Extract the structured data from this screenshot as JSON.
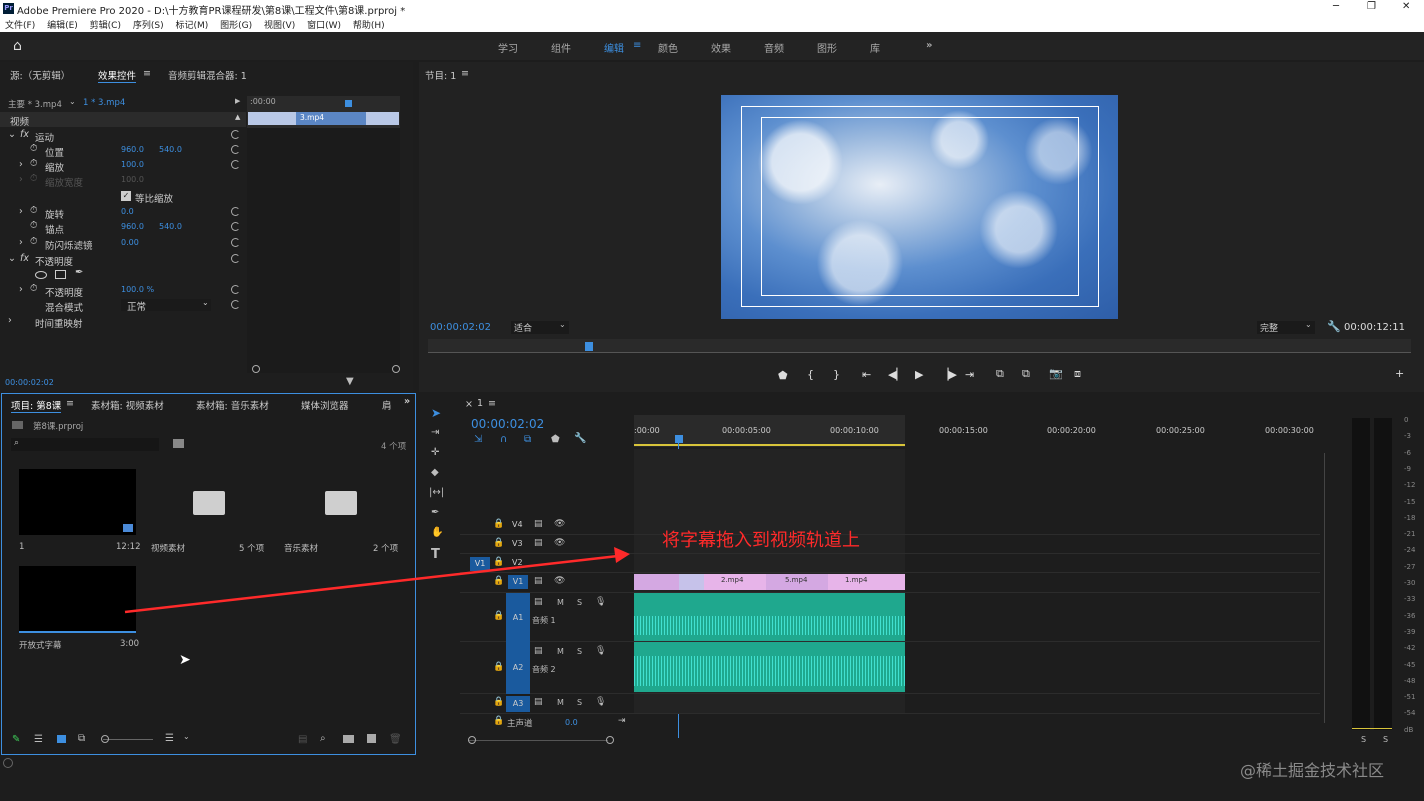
{
  "title": "Adobe Premiere Pro 2020 - D:\\十方教育PR课程研发\\第8课\\工程文件\\第8课.prproj *",
  "menu": [
    "文件(F)",
    "编辑(E)",
    "剪辑(C)",
    "序列(S)",
    "标记(M)",
    "图形(G)",
    "视图(V)",
    "窗口(W)",
    "帮助(H)"
  ],
  "workspaces": [
    "学习",
    "组件",
    "编辑",
    "颜色",
    "效果",
    "音频",
    "图形",
    "库"
  ],
  "effect_controls": {
    "tabs": [
      "源:（无剪辑）",
      "效果控件",
      "音频剪辑混合器: 1"
    ],
    "master": "主要 * 3.mp4",
    "clip": "1 * 3.mp4",
    "tl_time": ":00:00",
    "tl_clip": "3.mp4",
    "section": "视频",
    "motion": "运动",
    "position": "位置",
    "pos_x": "960.0",
    "pos_y": "540.0",
    "scale": "缩放",
    "scale_v": "100.0",
    "scale_w": "缩放宽度",
    "scale_w_v": "100.0",
    "uniform": "等比缩放",
    "rotation": "旋转",
    "rot_v": "0.0",
    "anchor": "锚点",
    "anc_x": "960.0",
    "anc_y": "540.0",
    "flicker": "防闪烁滤镜",
    "flicker_v": "0.00",
    "opacity_group": "不透明度",
    "opacity": "不透明度",
    "opacity_v": "100.0 %",
    "blend": "混合模式",
    "blend_v": "正常",
    "remap": "时间重映射",
    "time": "00:00:02:02"
  },
  "program": {
    "label": "节目: 1",
    "time": "00:00:02:02",
    "fit": "适合",
    "quality": "完整",
    "duration": "00:00:12:11"
  },
  "project": {
    "tabs": [
      "项目: 第8课",
      "素材箱: 视频素材",
      "素材箱: 音乐素材",
      "媒体浏览器",
      "肩"
    ],
    "file": "第8课.prproj",
    "count": "4 个项",
    "items": [
      {
        "name": "1",
        "meta": "12:12"
      },
      {
        "name": "视频素材",
        "meta": "5 个项"
      },
      {
        "name": "音乐素材",
        "meta": "2 个项"
      },
      {
        "name": "开放式字幕",
        "meta": "3:00"
      }
    ]
  },
  "timeline": {
    "seq": "1",
    "time": "00:00:02:02",
    "ruler": [
      ":00:00",
      "00:00:05:00",
      "00:00:10:00",
      "00:00:15:00",
      "00:00:20:00",
      "00:00:25:00",
      "00:00:30:00"
    ],
    "tracks": [
      "V4",
      "V3",
      "V2",
      "V1",
      "A1",
      "A2",
      "A3"
    ],
    "audio_names": {
      "a1": "音频 1",
      "a2": "音频 2",
      "master": "主声道",
      "master_v": "0.0"
    },
    "clips": [
      "2.mp4",
      "5.mp4",
      "1.mp4"
    ],
    "src_v1": "V1"
  },
  "annotation": "将字幕拖入到视频轨道上",
  "meter": {
    "ticks": [
      "0",
      "-3",
      "-6",
      "-9",
      "-12",
      "-15",
      "-18",
      "-21",
      "-24",
      "-27",
      "-30",
      "-33",
      "-36",
      "-39",
      "-42",
      "-45",
      "-48",
      "-51",
      "-54",
      "dB"
    ],
    "solo": [
      "S",
      "S"
    ]
  },
  "watermark": "@稀土掘金技术社区",
  "colors": {
    "accent": "#3d8fe0",
    "clip": "#e7b4e9",
    "audio": "#1fa88e",
    "annotation": "#ff2a2a"
  }
}
